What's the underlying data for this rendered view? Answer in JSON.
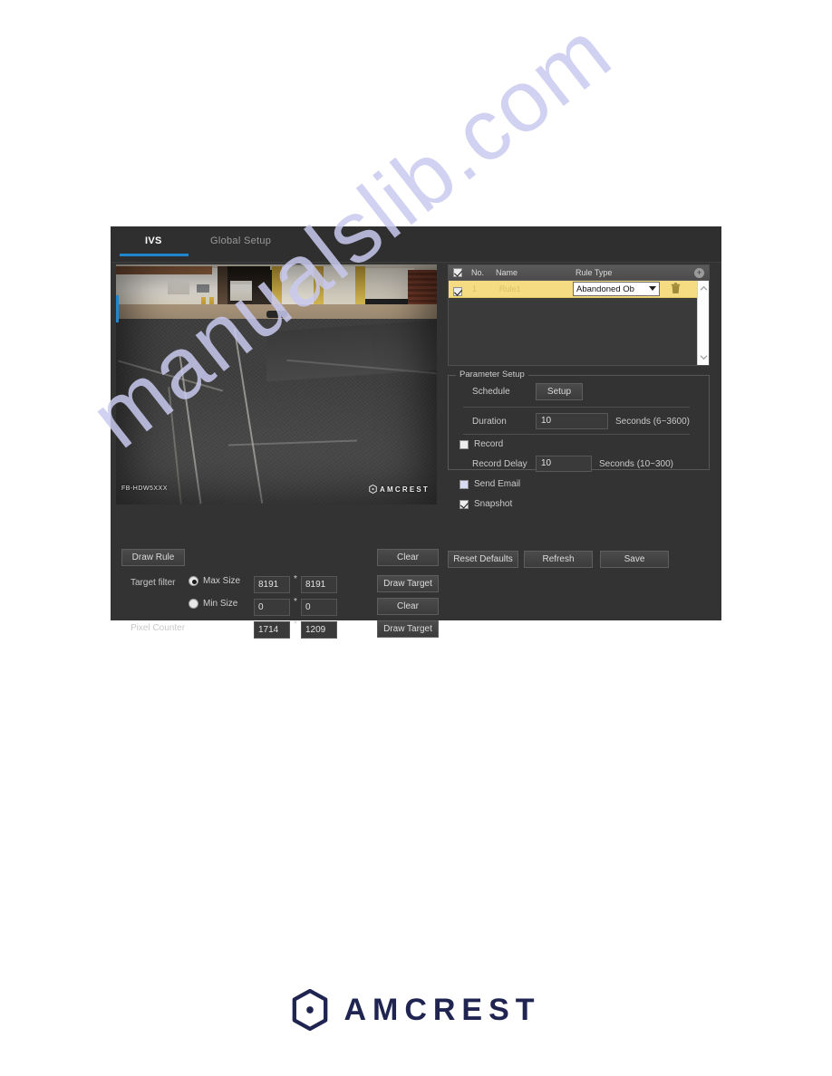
{
  "watermark": {
    "text": "manualslib.com"
  },
  "window": {
    "tabs": [
      {
        "label": "IVS",
        "active": true
      },
      {
        "label": "Global Setup",
        "active": false
      }
    ]
  },
  "video": {
    "osd_channel": "FB-HDW5XXX",
    "osd_brand": "AMCREST"
  },
  "left_panel": {
    "draw_rule_label": "Draw Rule",
    "clear_rule_label": "Clear",
    "target_filter_label": "Target filter",
    "max_size_label": "Max Size",
    "min_size_label": "Min Size",
    "pixel_counter_label": "Pixel Counter",
    "separator": "*",
    "max_size_width": "8191",
    "max_size_height": "8191",
    "min_size_width": "0",
    "min_size_height": "0",
    "pixel_counter_width": "1714",
    "pixel_counter_height": "1209",
    "draw_target_max_label": "Draw Target",
    "clear_min_label": "Clear",
    "draw_target_pixel_label": "Draw Target"
  },
  "rule_table": {
    "columns": {
      "no": "No.",
      "name": "Name",
      "rule_type": "Rule Type"
    },
    "add_icon": "+",
    "rows": [
      {
        "no": "1",
        "name": "Rule1",
        "rule_type": "Abandoned Ob",
        "checked": true
      }
    ]
  },
  "parameter_setup": {
    "legend": "Parameter Setup",
    "schedule_label": "Schedule",
    "schedule_button": "Setup",
    "duration_label": "Duration",
    "duration_value": "10",
    "duration_unit": "Seconds (6~3600)",
    "record_label": "Record",
    "record_checked": false,
    "record_delay_label": "Record Delay",
    "record_delay_value": "10",
    "record_delay_unit": "Seconds (10~300)",
    "send_email_label": "Send Email",
    "send_email_checked": false,
    "snapshot_label": "Snapshot",
    "snapshot_checked": true
  },
  "actions": {
    "reset_defaults": "Reset Defaults",
    "refresh": "Refresh",
    "save": "Save"
  },
  "footer": {
    "brand": "AMCREST"
  },
  "colors": {
    "accent_blue": "#1e87d0",
    "row_highlight": "#f5dc82",
    "panel_bg": "#333333",
    "brand_navy": "#1f2450"
  }
}
